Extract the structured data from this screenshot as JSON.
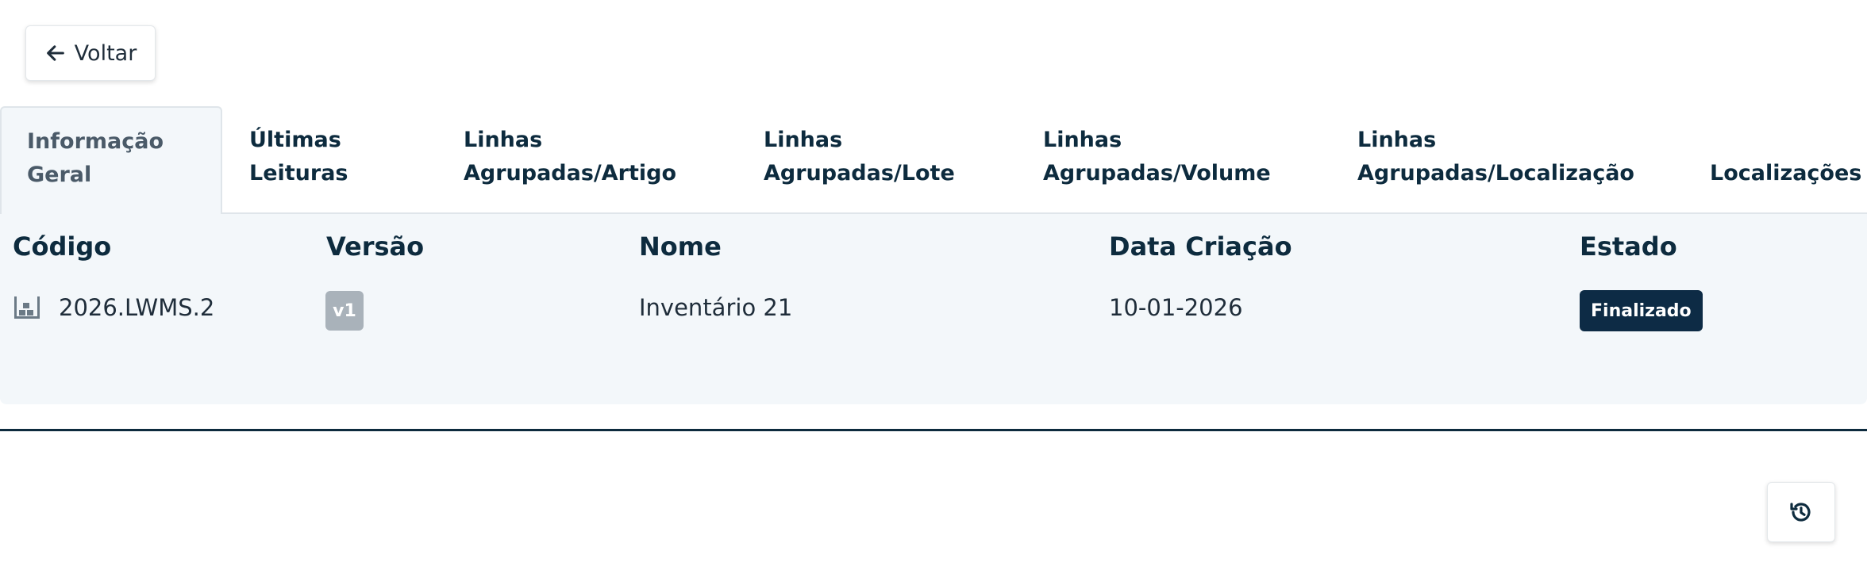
{
  "back_button": {
    "label": "Voltar",
    "icon": "arrow-left-icon"
  },
  "tabs": [
    {
      "line1": "Informação",
      "line2": "Geral",
      "active": true
    },
    {
      "line1": "Últimas",
      "line2": "Leituras"
    },
    {
      "line1": "Linhas",
      "line2": "Agrupadas/Artigo"
    },
    {
      "line1": "Linhas",
      "line2": "Agrupadas/Lote"
    },
    {
      "line1": "Linhas",
      "line2": "Agrupadas/Volume"
    },
    {
      "line1": "Linhas",
      "line2": "Agrupadas/Localização"
    },
    {
      "line1": "",
      "line2": "Localizações"
    }
  ],
  "table": {
    "headers": {
      "code": "Código",
      "version": "Versão",
      "name": "Nome",
      "created": "Data Criação",
      "status": "Estado"
    },
    "row": {
      "code": "2026.LWMS.2",
      "code_icon": "warehouse-icon",
      "version": "v1",
      "name": "Inventário 21",
      "created": "10-01-2026",
      "status": "Finalizado"
    }
  },
  "colors": {
    "primary": "#0d2b45",
    "panel_bg": "#f3f7fa",
    "badge_grey": "#a9b2ba"
  },
  "history_button": {
    "icon": "history-icon"
  }
}
